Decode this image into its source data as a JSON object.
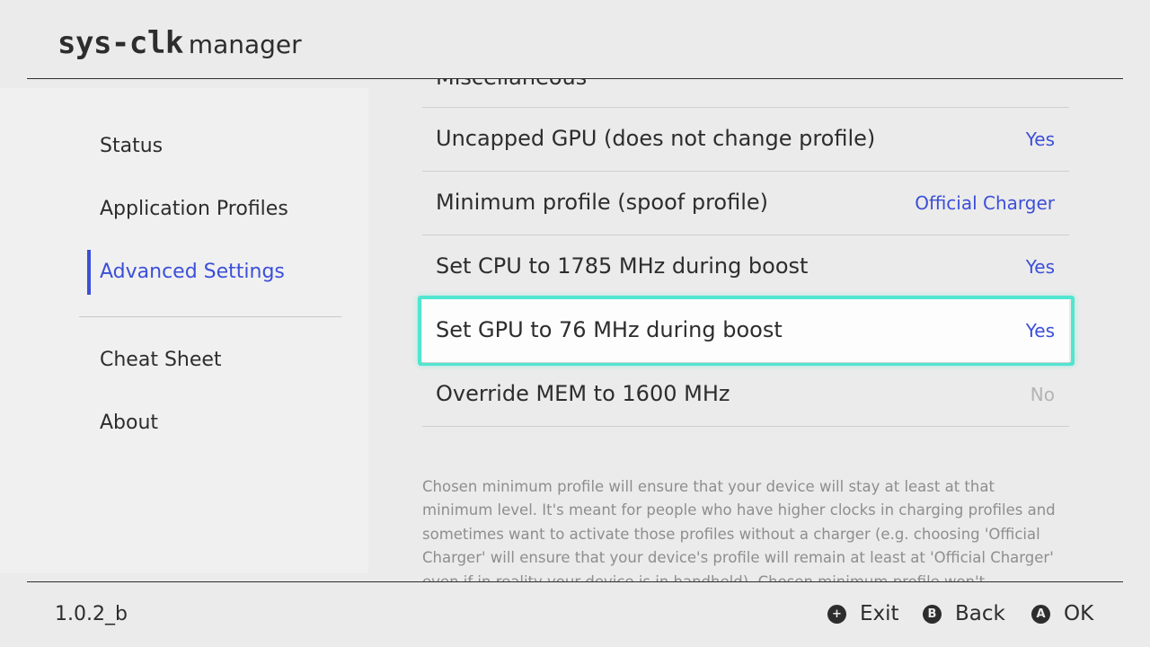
{
  "header": {
    "brand": "sys-clk",
    "subtitle": "manager"
  },
  "sidebar": {
    "items": [
      {
        "label": "Status",
        "active": false
      },
      {
        "label": "Application Profiles",
        "active": false
      },
      {
        "label": "Advanced Settings",
        "active": true
      },
      {
        "label": "Cheat Sheet",
        "active": false
      },
      {
        "label": "About",
        "active": false
      }
    ]
  },
  "settings": {
    "cut_off_heading": "Miscellaneous",
    "rows": [
      {
        "label": "Uncapped GPU (does not change profile)",
        "value": "Yes",
        "enabled": true
      },
      {
        "label": "Minimum profile (spoof profile)",
        "value": "Official Charger",
        "enabled": true
      },
      {
        "label": "Set CPU to 1785 MHz during boost",
        "value": "Yes",
        "enabled": true
      },
      {
        "label": "Set GPU to 76 MHz during boost",
        "value": "Yes",
        "enabled": true,
        "focused": true
      },
      {
        "label": "Override MEM to 1600 MHz",
        "value": "No",
        "enabled": false
      }
    ],
    "description": "Chosen minimum profile will ensure that your device will stay at least at that minimum level. It's meant for people who have higher clocks in charging profiles and sometimes want to activate those profiles without a charger (e.g. choosing 'Official Charger' will ensure that your device's profile will remain at least at 'Official Charger' even if in reality your device is in handheld). Chosen minimum profile won't downgrade your real profile if"
  },
  "footer": {
    "version": "1.0.2_b",
    "hints": [
      {
        "glyph": "+",
        "label": "Exit",
        "icon": "plus-button-icon"
      },
      {
        "glyph": "B",
        "label": "Back",
        "icon": "b-button-icon"
      },
      {
        "glyph": "A",
        "label": "OK",
        "icon": "a-button-icon"
      }
    ]
  },
  "colors": {
    "accent": "#3c4fd8",
    "focus": "#52e5d0",
    "background": "#ebebeb",
    "sidebar": "#f0f0f0",
    "disabled_value": "#b4b4b4",
    "text": "#2d2d2d"
  }
}
